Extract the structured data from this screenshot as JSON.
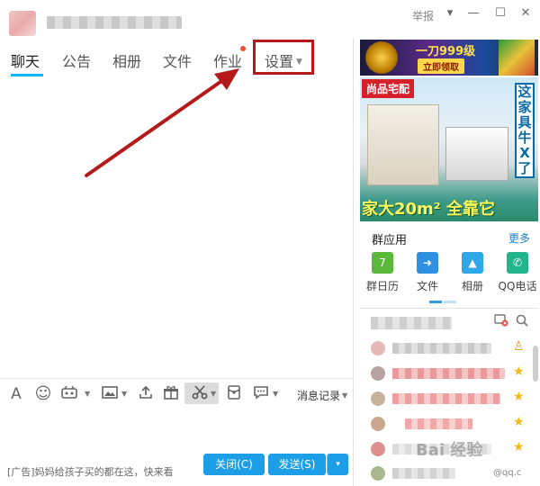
{
  "window": {
    "report": "举报",
    "controls": [
      "▾",
      "—",
      "☐",
      "✕"
    ]
  },
  "tabs": [
    {
      "label": "聊天",
      "active": true
    },
    {
      "label": "公告",
      "active": false
    },
    {
      "label": "相册",
      "active": false
    },
    {
      "label": "文件",
      "active": false
    },
    {
      "label": "作业",
      "active": false,
      "badge": true
    },
    {
      "label": "设置",
      "active": false,
      "dropdown": true
    }
  ],
  "toolbar": {
    "font_icon": "A",
    "emoji_icon": "☺",
    "history": "消息记录"
  },
  "bottom": {
    "ad": "[广告]妈妈给孩子买的都在这，快来看",
    "close": "关闭(C)",
    "send": "发送(S)",
    "send_more": "▾"
  },
  "ads": {
    "top_slogan": "一刀999级",
    "top_cta": "立即领取",
    "brand": "尚品宅配",
    "side_text": "这家具牛X了",
    "bottom_text": "家大20m² 全靠它"
  },
  "apps": {
    "title": "群应用",
    "more": "更多",
    "items": [
      {
        "label": "群日历",
        "icon": "7",
        "color": "#5cb83a"
      },
      {
        "label": "文件",
        "icon": "➜",
        "color": "#2f8fe0"
      },
      {
        "label": "相册",
        "icon": "▲",
        "color": "#2fa8e8"
      },
      {
        "label": "QQ电话",
        "icon": "✆",
        "color": "#23b58a"
      }
    ]
  },
  "watermark": {
    "baidu": "Bai 经验",
    "qq": "@qq.c"
  },
  "colors": {
    "accent": "#12b7f5",
    "button": "#1d9fe8",
    "highlight": "#b41a1a"
  }
}
